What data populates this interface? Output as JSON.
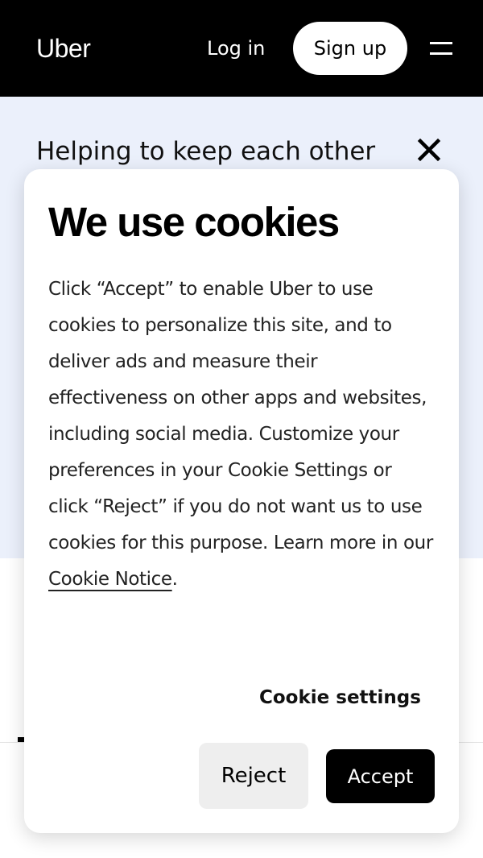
{
  "header": {
    "logo": "Uber",
    "login_label": "Log in",
    "signup_label": "Sign up",
    "menu_icon": "hamburger-menu-icon"
  },
  "banner": {
    "title": "Helping to keep each other",
    "close_icon": "close-icon",
    "background": "#ebf0fb"
  },
  "cookie_dialog": {
    "title": "We use cookies",
    "body_text": "Click “Accept” to enable Uber to use cookies to personalize this site, and to deliver ads and measure their effectiveness on other apps and websites, including social media. Customize your preferences in your Cookie Settings or click “Reject” if you do not want us to use cookies for this purpose. Learn more in our ",
    "notice_link": "Cookie Notice",
    "body_end": ".",
    "settings_label": "Cookie settings",
    "reject_label": "Reject",
    "accept_label": "Accept"
  }
}
